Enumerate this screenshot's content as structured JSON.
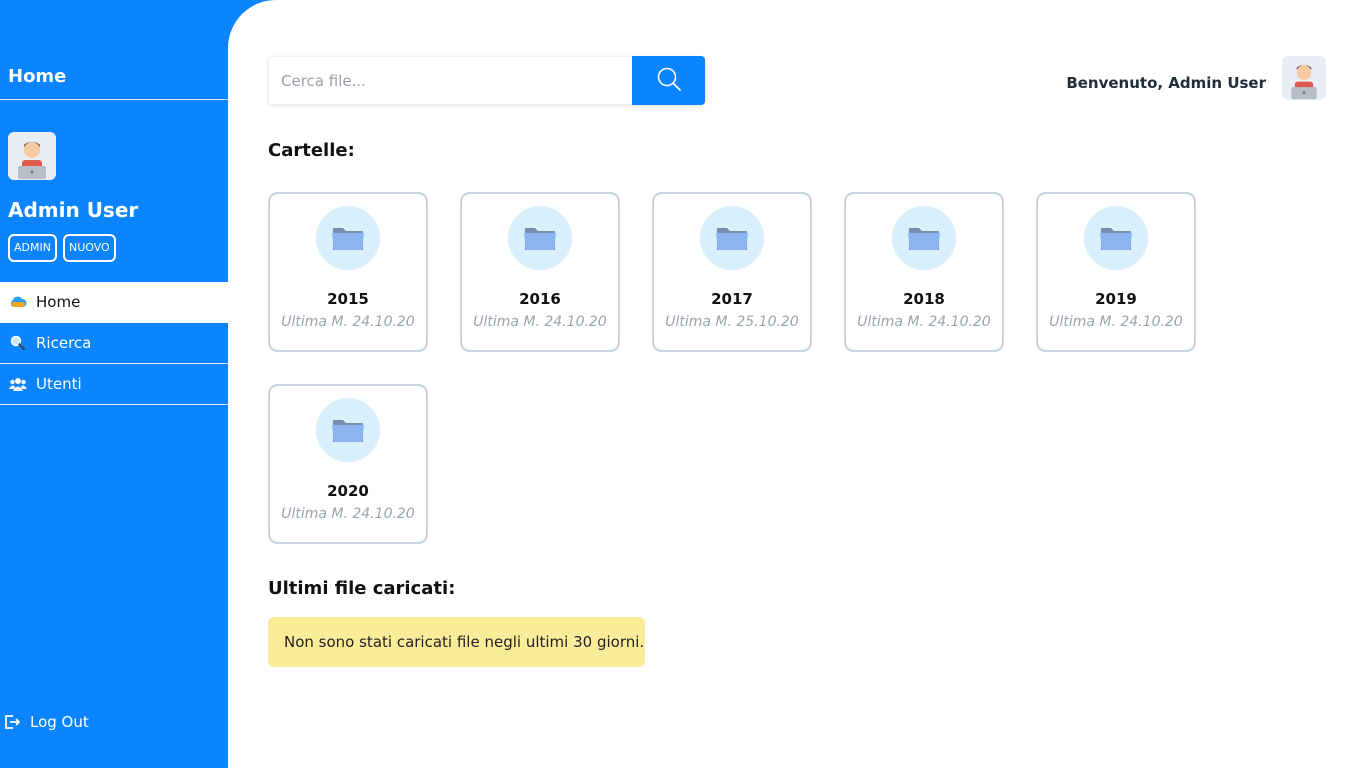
{
  "sidebar": {
    "home_title": "Home",
    "user_name": "Admin User",
    "badges": [
      "ADMIN",
      "NUOVO"
    ],
    "nav": [
      {
        "label": "Home",
        "icon": "cloud-icon"
      },
      {
        "label": "Ricerca",
        "icon": "search-icon"
      },
      {
        "label": "Utenti",
        "icon": "users-icon"
      }
    ],
    "logout_label": "Log Out"
  },
  "header": {
    "search_placeholder": "Cerca file...",
    "welcome": "Benvenuto, Admin User"
  },
  "folders_section": {
    "title": "Cartelle:",
    "folders": [
      {
        "name": "2015",
        "date": "Ultima M. 24.10.20"
      },
      {
        "name": "2016",
        "date": "Ultima M. 24.10.20"
      },
      {
        "name": "2017",
        "date": "Ultima M. 25.10.20"
      },
      {
        "name": "2018",
        "date": "Ultima M. 24.10.20"
      },
      {
        "name": "2019",
        "date": "Ultima M. 24.10.20"
      },
      {
        "name": "2020",
        "date": "Ultima M. 24.10.20"
      }
    ]
  },
  "recent_section": {
    "title": "Ultimi file caricati:",
    "notice": "Non sono stati caricati file negli ultimi 30 giorni."
  },
  "colors": {
    "accent": "#0a84ff",
    "notice_bg": "#fbec99",
    "folder_circle": "#d8effc"
  }
}
